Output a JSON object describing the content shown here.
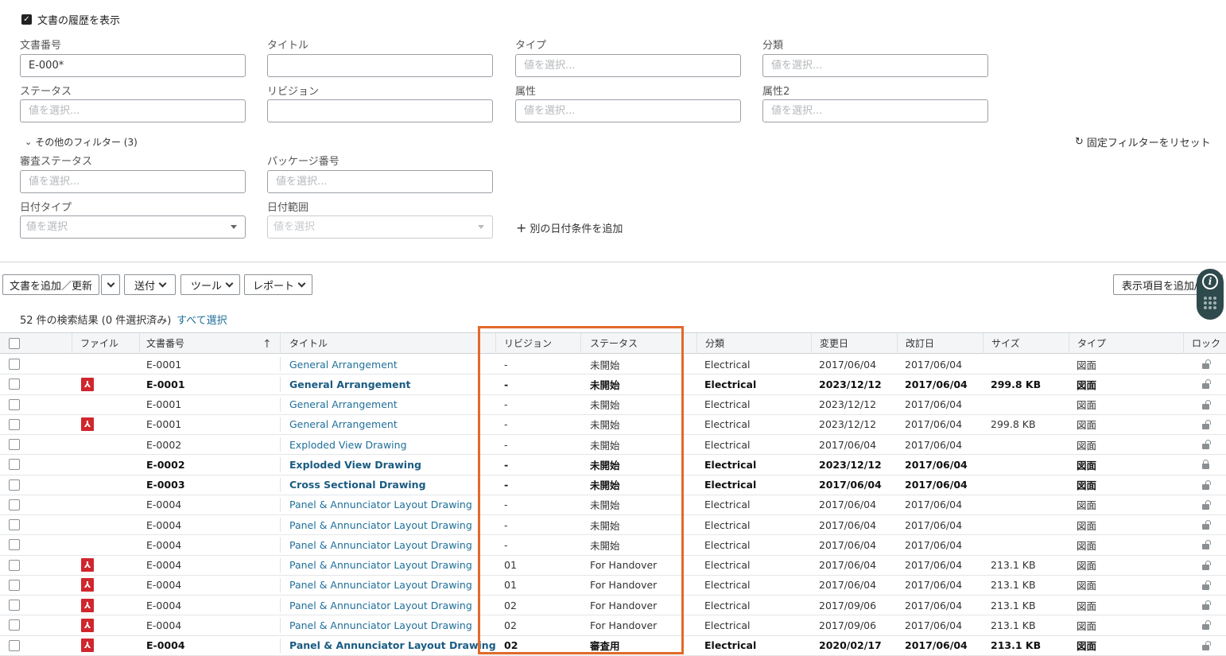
{
  "filters": {
    "show_history_label": "文書の履歴を表示",
    "doc_number": {
      "label": "文書番号",
      "value": "E-000*"
    },
    "title": {
      "label": "タイトル",
      "value": ""
    },
    "type": {
      "label": "タイプ",
      "placeholder": "値を選択..."
    },
    "category": {
      "label": "分類",
      "placeholder": "値を選択..."
    },
    "status": {
      "label": "ステータス",
      "placeholder": "値を選択..."
    },
    "revision": {
      "label": "リビジョン",
      "value": ""
    },
    "attribute": {
      "label": "属性",
      "placeholder": "値を選択..."
    },
    "attribute2": {
      "label": "属性2",
      "placeholder": "値を選択..."
    },
    "more_filters_label": "その他のフィルター (3)",
    "reset_label": "固定フィルターをリセット",
    "review_status": {
      "label": "審査ステータス",
      "placeholder": "値を選択..."
    },
    "package_number": {
      "label": "パッケージ番号",
      "placeholder": "値を選択..."
    },
    "date_type": {
      "label": "日付タイプ",
      "placeholder": "値を選択"
    },
    "date_range": {
      "label": "日付範囲",
      "placeholder": "値を選択"
    },
    "add_date_label": "別の日付条件を追加"
  },
  "toolbar": {
    "add_update": "文書を追加／更新",
    "send": "送付",
    "tools": "ツール",
    "report": "レポート",
    "add_columns": "表示項目を追加/"
  },
  "results": {
    "count_text": "52 件の検索結果 (0 件選択済み)",
    "select_all": "すべて選択"
  },
  "table": {
    "headers": {
      "file": "ファイル",
      "doc_number": "文書番号",
      "title": "タイトル",
      "revision": "リビジョン",
      "status": "ステータス",
      "category": "分類",
      "modified": "変更日",
      "revised": "改訂日",
      "size": "サイズ",
      "type": "タイプ",
      "lock": "ロック"
    },
    "rows": [
      {
        "pdf": false,
        "bold": false,
        "doc": "E-0001",
        "title": "General Arrangement",
        "rev": "-",
        "status": "未開始",
        "cat": "Electrical",
        "mod": "2017/06/04",
        "revd": "2017/06/04",
        "size": "",
        "type": "図面",
        "lock": "open"
      },
      {
        "pdf": true,
        "bold": true,
        "doc": "E-0001",
        "title": "General Arrangement",
        "rev": "-",
        "status": "未開始",
        "cat": "Electrical",
        "mod": "2023/12/12",
        "revd": "2017/06/04",
        "size": "299.8 KB",
        "type": "図面",
        "lock": "open"
      },
      {
        "pdf": false,
        "bold": false,
        "doc": "E-0001",
        "title": "General Arrangement",
        "rev": "-",
        "status": "未開始",
        "cat": "Electrical",
        "mod": "2023/12/12",
        "revd": "2017/06/04",
        "size": "",
        "type": "図面",
        "lock": "open"
      },
      {
        "pdf": true,
        "bold": false,
        "doc": "E-0001",
        "title": "General Arrangement",
        "rev": "-",
        "status": "未開始",
        "cat": "Electrical",
        "mod": "2023/12/12",
        "revd": "2017/06/04",
        "size": "299.8 KB",
        "type": "図面",
        "lock": "open"
      },
      {
        "pdf": false,
        "bold": false,
        "doc": "E-0002",
        "title": "Exploded View Drawing",
        "rev": "-",
        "status": "未開始",
        "cat": "Electrical",
        "mod": "2017/06/04",
        "revd": "2017/06/04",
        "size": "",
        "type": "図面",
        "lock": "open"
      },
      {
        "pdf": false,
        "bold": true,
        "doc": "E-0002",
        "title": "Exploded View Drawing",
        "rev": "-",
        "status": "未開始",
        "cat": "Electrical",
        "mod": "2023/12/12",
        "revd": "2017/06/04",
        "size": "",
        "type": "図面",
        "lock": "closed"
      },
      {
        "pdf": false,
        "bold": true,
        "doc": "E-0003",
        "title": "Cross Sectional Drawing",
        "rev": "-",
        "status": "未開始",
        "cat": "Electrical",
        "mod": "2017/06/04",
        "revd": "2017/06/04",
        "size": "",
        "type": "図面",
        "lock": "open"
      },
      {
        "pdf": false,
        "bold": false,
        "doc": "E-0004",
        "title": "Panel & Annunciator Layout Drawing",
        "rev": "-",
        "status": "未開始",
        "cat": "Electrical",
        "mod": "2017/06/04",
        "revd": "2017/06/04",
        "size": "",
        "type": "図面",
        "lock": "open"
      },
      {
        "pdf": false,
        "bold": false,
        "doc": "E-0004",
        "title": "Panel & Annunciator Layout Drawing",
        "rev": "-",
        "status": "未開始",
        "cat": "Electrical",
        "mod": "2017/06/04",
        "revd": "2017/06/04",
        "size": "",
        "type": "図面",
        "lock": "open"
      },
      {
        "pdf": false,
        "bold": false,
        "doc": "E-0004",
        "title": "Panel & Annunciator Layout Drawing",
        "rev": "-",
        "status": "未開始",
        "cat": "Electrical",
        "mod": "2017/06/04",
        "revd": "2017/06/04",
        "size": "",
        "type": "図面",
        "lock": "open"
      },
      {
        "pdf": true,
        "bold": false,
        "doc": "E-0004",
        "title": "Panel & Annunciator Layout Drawing",
        "rev": "01",
        "status": "For Handover",
        "cat": "Electrical",
        "mod": "2017/06/04",
        "revd": "2017/06/04",
        "size": "213.1 KB",
        "type": "図面",
        "lock": "open"
      },
      {
        "pdf": true,
        "bold": false,
        "doc": "E-0004",
        "title": "Panel & Annunciator Layout Drawing",
        "rev": "01",
        "status": "For Handover",
        "cat": "Electrical",
        "mod": "2017/06/04",
        "revd": "2017/06/04",
        "size": "213.1 KB",
        "type": "図面",
        "lock": "open"
      },
      {
        "pdf": true,
        "bold": false,
        "doc": "E-0004",
        "title": "Panel & Annunciator Layout Drawing",
        "rev": "02",
        "status": "For Handover",
        "cat": "Electrical",
        "mod": "2017/09/06",
        "revd": "2017/06/04",
        "size": "213.1 KB",
        "type": "図面",
        "lock": "open"
      },
      {
        "pdf": true,
        "bold": false,
        "doc": "E-0004",
        "title": "Panel & Annunciator Layout Drawing",
        "rev": "02",
        "status": "For Handover",
        "cat": "Electrical",
        "mod": "2017/09/06",
        "revd": "2017/06/04",
        "size": "213.1 KB",
        "type": "図面",
        "lock": "open"
      },
      {
        "pdf": true,
        "bold": true,
        "doc": "E-0004",
        "title": "Panel & Annunciator Layout Drawing",
        "rev": "02",
        "status": "審査用",
        "cat": "Electrical",
        "mod": "2020/02/17",
        "revd": "2017/06/04",
        "size": "213.1 KB",
        "type": "図面",
        "lock": "open-edit"
      }
    ]
  },
  "colors": {
    "highlight": "#e2692a",
    "link": "#1f6f99",
    "pdf": "#d0262d",
    "help_widget": "#2f4a4d"
  }
}
